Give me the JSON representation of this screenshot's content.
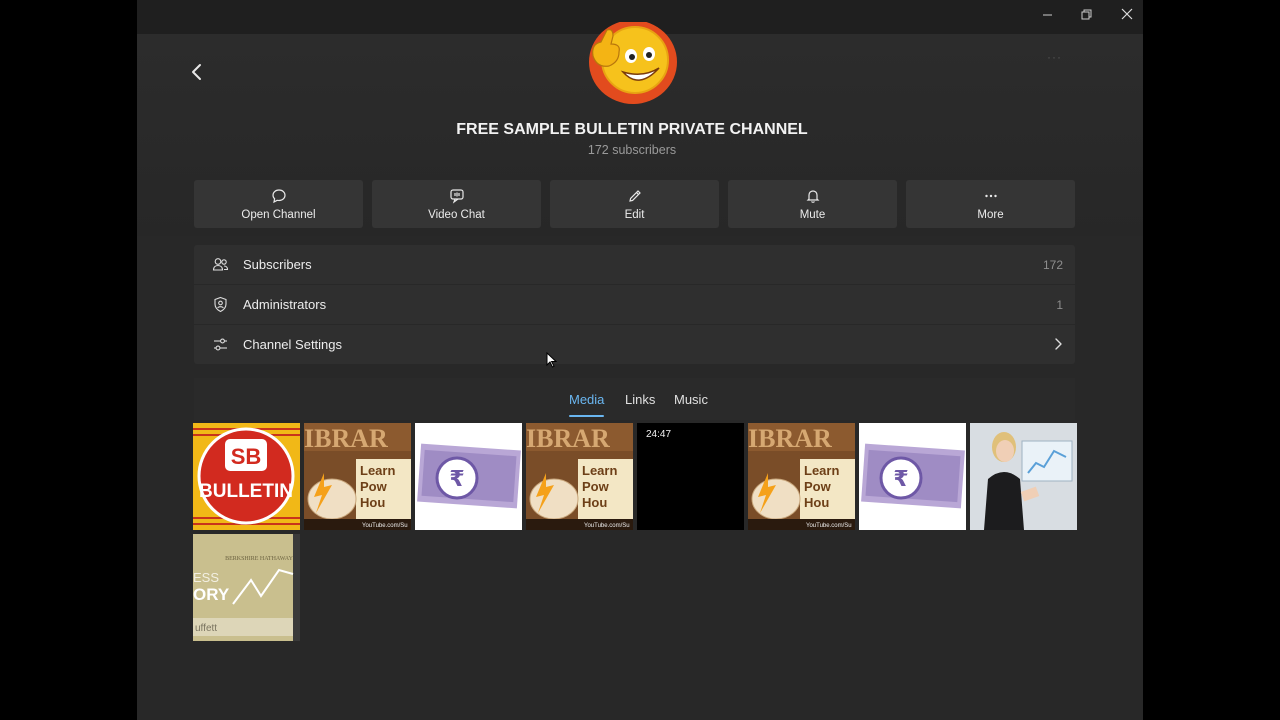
{
  "window_controls": {
    "minimize": "—",
    "restore": "❐",
    "close": "✕"
  },
  "channel": {
    "name": "FREE SAMPLE BULLETIN PRIVATE CHANNEL",
    "subscribers_text": "172 subscribers"
  },
  "actions": [
    {
      "label": "Open Channel",
      "icon": "chat-bubble-icon"
    },
    {
      "label": "Video Chat",
      "icon": "video-chat-icon"
    },
    {
      "label": "Edit",
      "icon": "pencil-icon"
    },
    {
      "label": "Mute",
      "icon": "bell-icon"
    },
    {
      "label": "More",
      "icon": "more-dots-icon"
    }
  ],
  "info_rows": [
    {
      "label": "Subscribers",
      "value": "172",
      "icon": "people-icon"
    },
    {
      "label": "Administrators",
      "value": "1",
      "icon": "shield-icon"
    },
    {
      "label": "Channel Settings",
      "icon": "sliders-icon"
    }
  ],
  "media_tabs": [
    "Media",
    "Links",
    "Music"
  ],
  "active_tab": "Media",
  "media": [
    {
      "kind": "bulletin-logo",
      "text": "BULLETIN",
      "mark": "SB"
    },
    {
      "kind": "library-thumb",
      "top": "IBRAR",
      "lines": [
        "Learn",
        "Pow",
        "Hou"
      ],
      "footer": "YouTube.com/Su"
    },
    {
      "kind": "rupee-thumb",
      "symbol": "₹"
    },
    {
      "kind": "library-thumb",
      "top": "IBRAR",
      "lines": [
        "Learn",
        "Pow",
        "Hou"
      ],
      "footer": "YouTube.com/Su"
    },
    {
      "kind": "video-thumb",
      "duration": "24:47"
    },
    {
      "kind": "library-thumb",
      "top": "IBRAR",
      "lines": [
        "Learn",
        "Pow",
        "Hou"
      ],
      "footer": "YouTube.com/Su"
    },
    {
      "kind": "rupee-thumb",
      "symbol": "₹"
    },
    {
      "kind": "presenter-photo"
    },
    {
      "kind": "book-thumb",
      "top": "BERKSHIRE HATHAWAY",
      "lines": [
        "ESS",
        "ORY"
      ],
      "footer": "uffett"
    }
  ],
  "colors": {
    "accent": "#6ab6f0",
    "window": "#282828",
    "panel": "#2f2f2f",
    "button": "#353535"
  }
}
